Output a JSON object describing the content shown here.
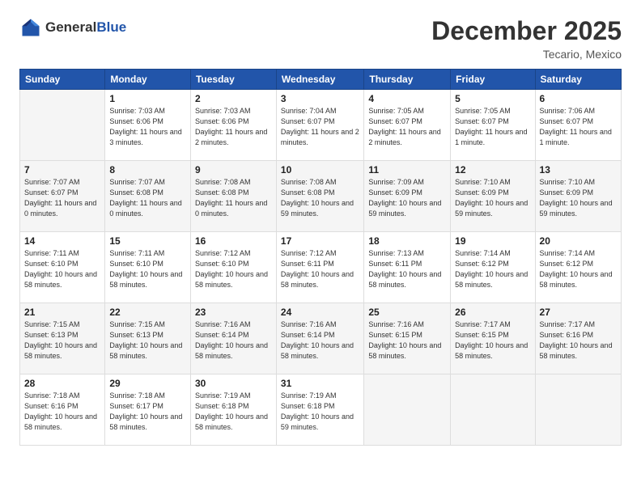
{
  "header": {
    "logo_general": "General",
    "logo_blue": "Blue",
    "month": "December 2025",
    "location": "Tecario, Mexico"
  },
  "days_of_week": [
    "Sunday",
    "Monday",
    "Tuesday",
    "Wednesday",
    "Thursday",
    "Friday",
    "Saturday"
  ],
  "weeks": [
    [
      {
        "num": "",
        "sunrise": "",
        "sunset": "",
        "daylight": ""
      },
      {
        "num": "1",
        "sunrise": "Sunrise: 7:03 AM",
        "sunset": "Sunset: 6:06 PM",
        "daylight": "Daylight: 11 hours and 3 minutes."
      },
      {
        "num": "2",
        "sunrise": "Sunrise: 7:03 AM",
        "sunset": "Sunset: 6:06 PM",
        "daylight": "Daylight: 11 hours and 2 minutes."
      },
      {
        "num": "3",
        "sunrise": "Sunrise: 7:04 AM",
        "sunset": "Sunset: 6:07 PM",
        "daylight": "Daylight: 11 hours and 2 minutes."
      },
      {
        "num": "4",
        "sunrise": "Sunrise: 7:05 AM",
        "sunset": "Sunset: 6:07 PM",
        "daylight": "Daylight: 11 hours and 2 minutes."
      },
      {
        "num": "5",
        "sunrise": "Sunrise: 7:05 AM",
        "sunset": "Sunset: 6:07 PM",
        "daylight": "Daylight: 11 hours and 1 minute."
      },
      {
        "num": "6",
        "sunrise": "Sunrise: 7:06 AM",
        "sunset": "Sunset: 6:07 PM",
        "daylight": "Daylight: 11 hours and 1 minute."
      }
    ],
    [
      {
        "num": "7",
        "sunrise": "Sunrise: 7:07 AM",
        "sunset": "Sunset: 6:07 PM",
        "daylight": "Daylight: 11 hours and 0 minutes."
      },
      {
        "num": "8",
        "sunrise": "Sunrise: 7:07 AM",
        "sunset": "Sunset: 6:08 PM",
        "daylight": "Daylight: 11 hours and 0 minutes."
      },
      {
        "num": "9",
        "sunrise": "Sunrise: 7:08 AM",
        "sunset": "Sunset: 6:08 PM",
        "daylight": "Daylight: 11 hours and 0 minutes."
      },
      {
        "num": "10",
        "sunrise": "Sunrise: 7:08 AM",
        "sunset": "Sunset: 6:08 PM",
        "daylight": "Daylight: 10 hours and 59 minutes."
      },
      {
        "num": "11",
        "sunrise": "Sunrise: 7:09 AM",
        "sunset": "Sunset: 6:09 PM",
        "daylight": "Daylight: 10 hours and 59 minutes."
      },
      {
        "num": "12",
        "sunrise": "Sunrise: 7:10 AM",
        "sunset": "Sunset: 6:09 PM",
        "daylight": "Daylight: 10 hours and 59 minutes."
      },
      {
        "num": "13",
        "sunrise": "Sunrise: 7:10 AM",
        "sunset": "Sunset: 6:09 PM",
        "daylight": "Daylight: 10 hours and 59 minutes."
      }
    ],
    [
      {
        "num": "14",
        "sunrise": "Sunrise: 7:11 AM",
        "sunset": "Sunset: 6:10 PM",
        "daylight": "Daylight: 10 hours and 58 minutes."
      },
      {
        "num": "15",
        "sunrise": "Sunrise: 7:11 AM",
        "sunset": "Sunset: 6:10 PM",
        "daylight": "Daylight: 10 hours and 58 minutes."
      },
      {
        "num": "16",
        "sunrise": "Sunrise: 7:12 AM",
        "sunset": "Sunset: 6:10 PM",
        "daylight": "Daylight: 10 hours and 58 minutes."
      },
      {
        "num": "17",
        "sunrise": "Sunrise: 7:12 AM",
        "sunset": "Sunset: 6:11 PM",
        "daylight": "Daylight: 10 hours and 58 minutes."
      },
      {
        "num": "18",
        "sunrise": "Sunrise: 7:13 AM",
        "sunset": "Sunset: 6:11 PM",
        "daylight": "Daylight: 10 hours and 58 minutes."
      },
      {
        "num": "19",
        "sunrise": "Sunrise: 7:14 AM",
        "sunset": "Sunset: 6:12 PM",
        "daylight": "Daylight: 10 hours and 58 minutes."
      },
      {
        "num": "20",
        "sunrise": "Sunrise: 7:14 AM",
        "sunset": "Sunset: 6:12 PM",
        "daylight": "Daylight: 10 hours and 58 minutes."
      }
    ],
    [
      {
        "num": "21",
        "sunrise": "Sunrise: 7:15 AM",
        "sunset": "Sunset: 6:13 PM",
        "daylight": "Daylight: 10 hours and 58 minutes."
      },
      {
        "num": "22",
        "sunrise": "Sunrise: 7:15 AM",
        "sunset": "Sunset: 6:13 PM",
        "daylight": "Daylight: 10 hours and 58 minutes."
      },
      {
        "num": "23",
        "sunrise": "Sunrise: 7:16 AM",
        "sunset": "Sunset: 6:14 PM",
        "daylight": "Daylight: 10 hours and 58 minutes."
      },
      {
        "num": "24",
        "sunrise": "Sunrise: 7:16 AM",
        "sunset": "Sunset: 6:14 PM",
        "daylight": "Daylight: 10 hours and 58 minutes."
      },
      {
        "num": "25",
        "sunrise": "Sunrise: 7:16 AM",
        "sunset": "Sunset: 6:15 PM",
        "daylight": "Daylight: 10 hours and 58 minutes."
      },
      {
        "num": "26",
        "sunrise": "Sunrise: 7:17 AM",
        "sunset": "Sunset: 6:15 PM",
        "daylight": "Daylight: 10 hours and 58 minutes."
      },
      {
        "num": "27",
        "sunrise": "Sunrise: 7:17 AM",
        "sunset": "Sunset: 6:16 PM",
        "daylight": "Daylight: 10 hours and 58 minutes."
      }
    ],
    [
      {
        "num": "28",
        "sunrise": "Sunrise: 7:18 AM",
        "sunset": "Sunset: 6:16 PM",
        "daylight": "Daylight: 10 hours and 58 minutes."
      },
      {
        "num": "29",
        "sunrise": "Sunrise: 7:18 AM",
        "sunset": "Sunset: 6:17 PM",
        "daylight": "Daylight: 10 hours and 58 minutes."
      },
      {
        "num": "30",
        "sunrise": "Sunrise: 7:19 AM",
        "sunset": "Sunset: 6:18 PM",
        "daylight": "Daylight: 10 hours and 58 minutes."
      },
      {
        "num": "31",
        "sunrise": "Sunrise: 7:19 AM",
        "sunset": "Sunset: 6:18 PM",
        "daylight": "Daylight: 10 hours and 59 minutes."
      },
      {
        "num": "",
        "sunrise": "",
        "sunset": "",
        "daylight": ""
      },
      {
        "num": "",
        "sunrise": "",
        "sunset": "",
        "daylight": ""
      },
      {
        "num": "",
        "sunrise": "",
        "sunset": "",
        "daylight": ""
      }
    ]
  ]
}
